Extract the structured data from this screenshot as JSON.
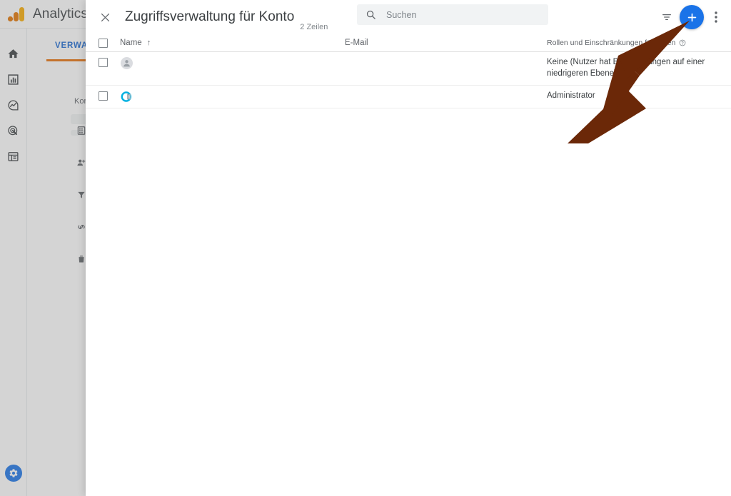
{
  "app": {
    "brand": "Analytics",
    "logo_icon": "google-analytics-logo",
    "sidebar": {
      "items": [
        {
          "icon": "home-icon",
          "label": "Startseite"
        },
        {
          "icon": "bar-chart-icon",
          "label": "Berichte"
        },
        {
          "icon": "explore-icon",
          "label": "Explorative Datenanalyse"
        },
        {
          "icon": "advertising-target-icon",
          "label": "Werbung"
        },
        {
          "icon": "library-list-icon",
          "label": "Bibliothek"
        }
      ],
      "settings": {
        "icon": "gear-icon",
        "label": "Verwaltung"
      }
    },
    "background": {
      "tab_label": "VERWALTUNG",
      "section_label": "Konto",
      "admin_icons": [
        "grid-icon",
        "person-add-icon",
        "filter-funnel-icon",
        "link-money-icon",
        "trash-icon"
      ],
      "accent_color": "#e8710a",
      "tab_color": "#1967d2"
    }
  },
  "panel": {
    "close_icon": "close-icon",
    "title": "Zugriffsverwaltung für Konto",
    "row_count": "2 Zeilen",
    "search": {
      "icon": "search-icon",
      "placeholder": "Suchen",
      "value": ""
    },
    "filter_icon": "filter-icon",
    "add_button": {
      "icon": "plus-icon",
      "label": "+",
      "color": "#1a73e8"
    },
    "more_icon": "more-vert-icon",
    "table": {
      "select_all_checkbox": false,
      "columns": [
        {
          "key": "name",
          "label": "Name",
          "sort": "↑"
        },
        {
          "key": "email",
          "label": "E-Mail"
        },
        {
          "key": "roles",
          "label": "Rollen und Einschränkungen für Daten",
          "help_icon": "help-circle-icon"
        }
      ],
      "rows": [
        {
          "selected": false,
          "avatar": "generic-person-avatar",
          "name": "         ",
          "email": "            ",
          "roles": "Keine (Nutzer hat Berechtigungen auf einer niedrigeren Ebene)",
          "row_menu_icon": "more-vert-icon"
        },
        {
          "selected": false,
          "avatar": "brand-logo-avatar",
          "name": "          ",
          "email": "             ",
          "roles": "Administrator",
          "row_menu_icon": "more-vert-icon"
        }
      ]
    }
  },
  "annotation": {
    "arrow": {
      "name": "pointer-arrow",
      "color": "#6b2808",
      "points_to": "add-user-button"
    }
  }
}
